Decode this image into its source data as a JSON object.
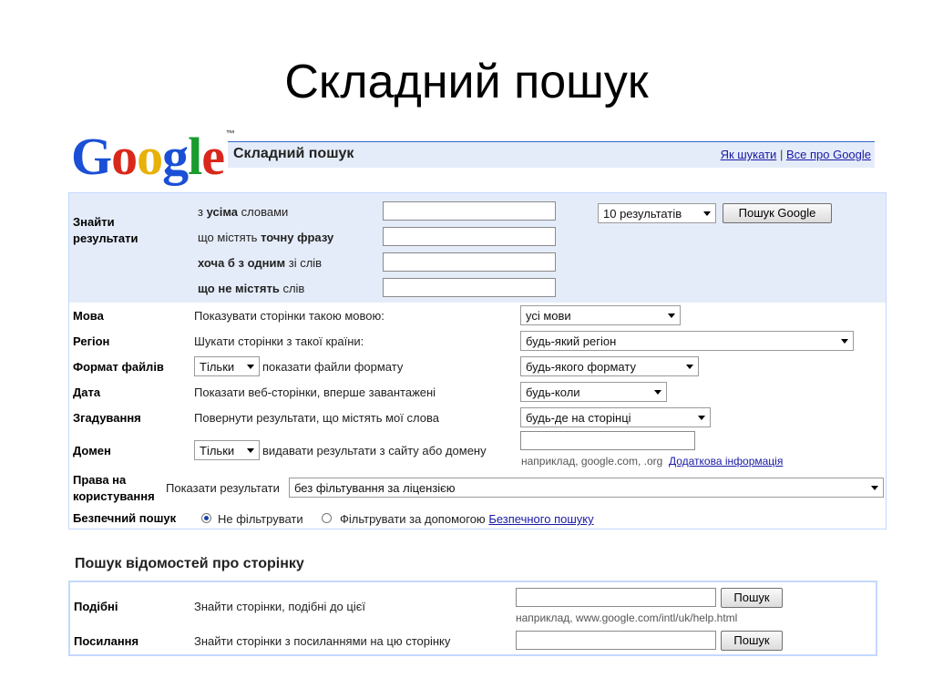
{
  "slide_title": "Складний пошук",
  "logo": {
    "text": "Google",
    "tm": "™"
  },
  "header": {
    "title": "Складний пошук",
    "link_how": "Як шукати",
    "separator": "|",
    "link_about": "Все про Google"
  },
  "find": {
    "label_line1": "Знайти",
    "label_line2": "результати",
    "rows": [
      {
        "pre": "з ",
        "bold": "усіма",
        "post": " словами",
        "value": ""
      },
      {
        "pre": "що містять ",
        "bold": "точну фразу",
        "post": "",
        "value": ""
      },
      {
        "pre": "",
        "bold": "хоча б з одним",
        "post": " зі слів",
        "value": ""
      },
      {
        "pre": "",
        "bold": "що не містять",
        "post": " слів",
        "value": ""
      }
    ],
    "results_select": "10 результатів",
    "search_button": "Пошук Google"
  },
  "options": {
    "language": {
      "label": "Мова",
      "desc": "Показувати сторінки такою мовою:",
      "value": "усі мови"
    },
    "region": {
      "label": "Регіон",
      "desc": "Шукати сторінки з такої країни:",
      "value": "будь-який регіон"
    },
    "filetype": {
      "label": "Формат файлів",
      "mode": "Тільки",
      "desc": "показати файли формату",
      "value": "будь-якого формату"
    },
    "date": {
      "label": "Дата",
      "desc": "Показати веб-сторінки, вперше завантажені",
      "value": "будь-коли"
    },
    "occurrence": {
      "label": "Згадування",
      "desc": "Повернути результати, що містять мої слова",
      "value": "будь-де на сторінці"
    },
    "domain": {
      "label": "Домен",
      "mode": "Тільки",
      "desc": "видавати результати з сайту або домену",
      "value": "",
      "hint": "наприклад, google.com, .org",
      "hint_link": "Додаткова інформація"
    },
    "rights": {
      "label_line1": "Права на",
      "label_line2": "користування",
      "desc": "Показати результати",
      "value": "без фільтування за ліцензією"
    },
    "safe": {
      "label": "Безпечний пошук",
      "opt1": "Не фільтрувати",
      "opt2_pre": "Фільтрувати за допомогою",
      "opt2_link": "Безпечного пошуку"
    }
  },
  "page_info": {
    "title": "Пошук відомостей про сторінку",
    "similar": {
      "label": "Подібні",
      "desc": "Знайти сторінки, подібні до цієї",
      "value": "",
      "button": "Пошук",
      "hint": "наприклад, www.google.com/intl/uk/help.html"
    },
    "links": {
      "label": "Посилання",
      "desc": "Знайти сторінки з посиланнями на цю сторінку",
      "value": "",
      "button": "Пошук"
    }
  }
}
